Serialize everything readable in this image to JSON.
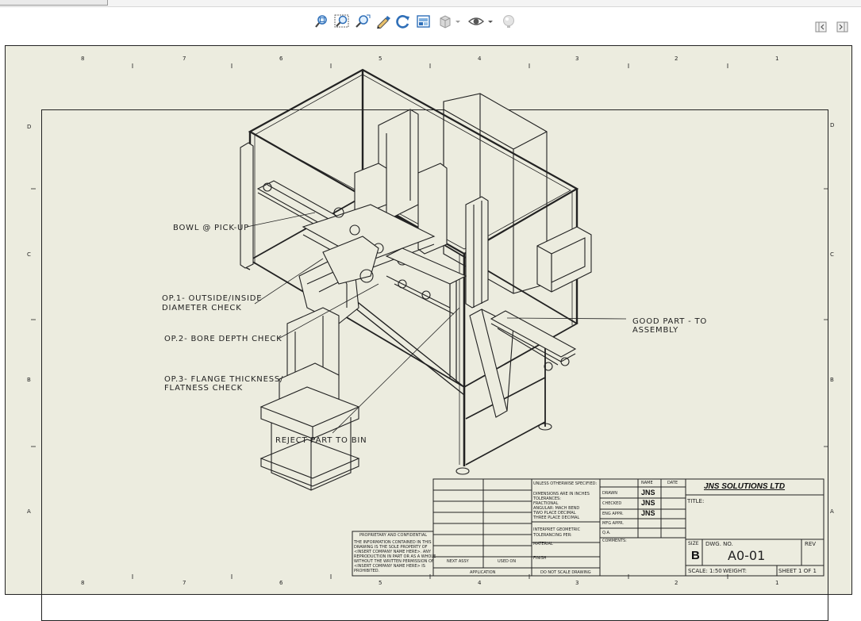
{
  "topbar": {
    "tab_fragment": ""
  },
  "toolbar": {
    "buttons": [
      {
        "name": "zoom-to-fit-button"
      },
      {
        "name": "zoom-to-area-button"
      },
      {
        "name": "zoom-in-out-button"
      },
      {
        "name": "rotate-view-button"
      },
      {
        "name": "previous-view-button"
      },
      {
        "name": "section-view-button"
      },
      {
        "name": "display-style-button"
      },
      {
        "name": "hide-show-items-button"
      },
      {
        "name": "appearance-button"
      }
    ]
  },
  "drawing": {
    "zones_top": [
      "8",
      "7",
      "6",
      "5",
      "4",
      "3",
      "2",
      "1"
    ],
    "zones_bottom": [
      "8",
      "7",
      "6",
      "5",
      "4",
      "3",
      "2",
      "1"
    ],
    "zones_left": [
      "D",
      "C",
      "B",
      "A"
    ],
    "zones_right": [
      "D",
      "C",
      "B",
      "A"
    ],
    "callouts": {
      "bowl": "BOWL @ PICK-UP",
      "op1_line1": "OP.1- OUTSIDE/INSIDE",
      "op1_line2": "DIAMETER CHECK",
      "op2": "OP.2- BORE DEPTH CHECK",
      "op3_line1": "OP.3- FLANGE THICKNESS/",
      "op3_line2": "FLATNESS CHECK",
      "reject": "REJECT PART TO BIN",
      "good_line1": "GOOD PART - TO",
      "good_line2": "ASSEMBLY"
    }
  },
  "title_block": {
    "company": "JNS SOLUTIONS LTD",
    "title_label": "TITLE:",
    "size_label": "SIZE",
    "size_value": "B",
    "dwg_no_label": "DWG. NO.",
    "dwg_no_value": "A0-01",
    "rev_label": "REV",
    "scale": "SCALE: 1:50",
    "weight": "WEIGHT:",
    "sheet": "SHEET 1 OF 1",
    "name_col": "NAME",
    "date_col": "DATE",
    "rows": [
      {
        "label": "DRAWN",
        "name": "JNS"
      },
      {
        "label": "CHECKED",
        "name": "JNS"
      },
      {
        "label": "ENG APPR.",
        "name": "JNS"
      },
      {
        "label": "MFG APPR.",
        "name": ""
      },
      {
        "label": "Q.A.",
        "name": ""
      },
      {
        "label": "COMMENTS:",
        "name": ""
      }
    ],
    "tolerance_lines": [
      "UNLESS OTHERWISE SPECIFIED:",
      "DIMENSIONS ARE IN INCHES",
      "TOLERANCES:",
      "FRACTIONAL",
      "ANGULAR: MACH    BEND",
      "TWO PLACE DECIMAL",
      "THREE PLACE DECIMAL"
    ],
    "interpret": "INTERPRET GEOMETRIC",
    "tolerancing": "TOLERANCING PER:",
    "material": "MATERIAL",
    "finish": "FINISH",
    "next_assy": "NEXT ASSY",
    "used_on": "USED ON",
    "application": "APPLICATION",
    "do_not_scale": "DO NOT SCALE DRAWING",
    "proprietary_lines": [
      "PROPRIETARY AND CONFIDENTIAL",
      "THE INFORMATION CONTAINED IN THIS",
      "DRAWING IS THE SOLE PROPERTY OF",
      "<INSERT COMPANY NAME HERE>. ANY",
      "REPRODUCTION IN PART OR AS A WHOLE",
      "WITHOUT THE WRITTEN PERMISSION OF",
      "<INSERT COMPANY NAME HERE> IS",
      "PROHIBITED."
    ]
  },
  "colors": {
    "sheet_bg": "#ececdf",
    "line": "#222222",
    "toolbar_icon": "#2f6fb8"
  }
}
